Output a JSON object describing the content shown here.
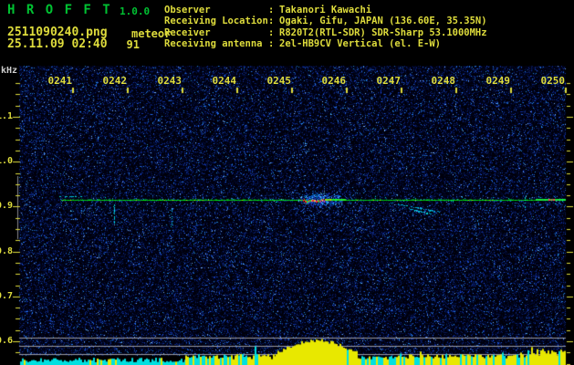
{
  "header": {
    "app_title": "H R O F F T",
    "version": "1.0.0",
    "filename": "2511090240.png",
    "mode": "meteor",
    "datetime": "25.11.09 02:40",
    "echo_count": "91",
    "separator": ":",
    "info_rows": [
      {
        "label": "Observer",
        "value": "Takanori Kawachi"
      },
      {
        "label": "Receiving Location",
        "value": "Ogaki, Gifu, JAPAN (136.60E, 35.35N)"
      },
      {
        "label": "Receiver",
        "value": "R820T2(RTL-SDR) SDR-Sharp 53.1000MHz"
      },
      {
        "label": "Receiving antenna",
        "value": "2el-HB9CV Vertical (el. E-W)"
      }
    ]
  },
  "colors": {
    "title_green": "#00c232",
    "text_yellow": "#dedc3c",
    "axis_yellow": "#dedc3c",
    "khz_white": "#cfcfcf",
    "grid_gray": "#9a9aa0",
    "band_marker_gray": "#8a8a92",
    "carrier_green": "#00e000",
    "echo_red": "#ff2828",
    "echo_magenta": "#e23cb4",
    "strip_cyan": "#00e0e0",
    "strip_yellow": "#e8e800"
  },
  "chart_data": {
    "type": "heatmap",
    "title": "",
    "xlabel": "",
    "ylabel": "kHz",
    "x_ticks": [
      "0241",
      "0242",
      "0243",
      "0244",
      "0245",
      "0246",
      "0247",
      "0248",
      "0249",
      "0250"
    ],
    "y_ticks": [
      "1.1",
      "1.0",
      "0.9",
      "0.8",
      "0.7",
      "0.6"
    ],
    "y_tick_khz": [
      1.1,
      1.0,
      0.9,
      0.8,
      0.7,
      0.6
    ],
    "x_range_minutes": [
      0,
      10
    ],
    "y_range_khz": [
      0.57,
      1.21
    ],
    "grid": false,
    "legend": false,
    "strip_ref_lines_khz": [
      0.608,
      0.59,
      0.572
    ],
    "detection_band_khz": [
      0.828,
      0.968
    ],
    "events": [
      {
        "kind": "carrier",
        "t0": 0.78,
        "t1": 10.0,
        "khz": 0.915
      },
      {
        "kind": "patch",
        "t0": 0.73,
        "t1": 1.17,
        "khz": 0.923
      },
      {
        "kind": "spike",
        "t": 1.75,
        "khz_from": 0.86,
        "khz_to": 0.905
      },
      {
        "kind": "spike",
        "t": 2.8,
        "khz_from": 0.852,
        "khz_to": 0.897
      },
      {
        "kind": "echo",
        "t0": 5.13,
        "t1": 5.97,
        "khz": 0.915
      },
      {
        "kind": "trail",
        "t0": 6.8,
        "t1": 7.72,
        "khz_from": 0.909,
        "khz_to": 0.889
      },
      {
        "kind": "trail",
        "t0": 7.1,
        "t1": 7.55,
        "khz_from": 0.897,
        "khz_to": 0.885
      },
      {
        "kind": "spike",
        "t": 9.25,
        "khz_from": 0.887,
        "khz_to": 0.933
      },
      {
        "kind": "bright_tail",
        "t0": 9.45,
        "t1": 10.0,
        "khz": 0.915
      }
    ],
    "signal_strip_segments": [
      {
        "t0": 0.03,
        "t1": 3.05,
        "h_base": 3,
        "h_var": 5,
        "yellow_prob": 0.05
      },
      {
        "t0": 3.05,
        "t1": 4.7,
        "h_base": 6,
        "h_var": 6,
        "yellow_prob": 0.55,
        "spike_prob": 0.1,
        "spike_add": 14
      },
      {
        "t0": 4.7,
        "t1": 6.2,
        "h_base": 6,
        "h_var": 4,
        "yellow_prob": 0.97,
        "hump": {
          "center": 5.45,
          "sigma": 0.55,
          "peak": 22
        }
      },
      {
        "t0": 6.2,
        "t1": 6.9,
        "h_base": 6,
        "h_var": 4,
        "yellow_prob": 0.35
      },
      {
        "t0": 6.9,
        "t1": 9.3,
        "h_base": 7,
        "h_var": 5,
        "yellow_prob": 0.72,
        "spike_prob": 0.05,
        "spike_add": 8
      },
      {
        "t0": 9.3,
        "t1": 10.0,
        "h_base": 10,
        "h_var": 8,
        "yellow_prob": 0.85,
        "spike_prob": 0.15,
        "spike_add": 8
      }
    ]
  }
}
